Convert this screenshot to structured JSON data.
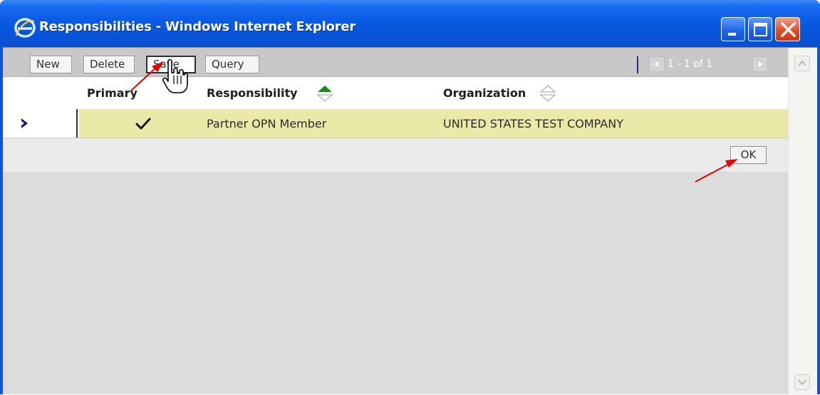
{
  "window": {
    "title": "Responsibilities - Windows Internet Explorer"
  },
  "toolbar": {
    "new_label": "New",
    "delete_label": "Delete",
    "save_label": "Save",
    "query_label": "Query"
  },
  "pager": {
    "text": "1 - 1 of 1"
  },
  "grid": {
    "columns": [
      {
        "label": "Primary"
      },
      {
        "label": "Responsibility",
        "sort": "ascending"
      },
      {
        "label": "Organization",
        "sort": "none"
      }
    ],
    "rows": [
      {
        "selected": true,
        "primary": true,
        "responsibility": "Partner OPN Member",
        "organization": "UNITED STATES TEST COMPANY"
      }
    ]
  },
  "footer": {
    "ok_label": "OK"
  },
  "colors": {
    "titlebar": "#0a55e0",
    "selected_row": "#ebe9a8",
    "sort_active": "#1e8a1e",
    "annotation_arrow": "#e60000"
  },
  "icons": {
    "app": "internet-explorer-icon",
    "minimize": "minimize-icon",
    "maximize": "maximize-icon",
    "close": "close-icon",
    "row_indicator": "chevron-right-icon",
    "primary": "checkmark-icon",
    "cursor": "hand-pointer-icon"
  }
}
